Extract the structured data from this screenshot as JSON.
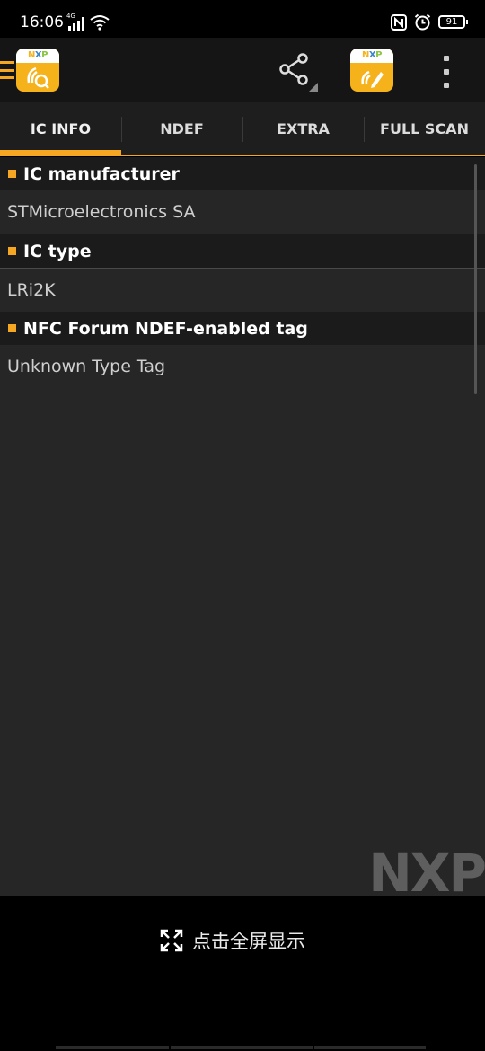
{
  "status_bar": {
    "time": "16:06",
    "network_type": "4G",
    "battery_level": "91"
  },
  "app_bar": {
    "menu_icon": "hamburger-icon",
    "logo_label": "NXP",
    "share_icon": "share-icon",
    "tagwriter_label": "NXP",
    "overflow_icon": "more-vert-icon"
  },
  "tabs": [
    {
      "label": "IC INFO",
      "active": true
    },
    {
      "label": "NDEF",
      "active": false
    },
    {
      "label": "EXTRA",
      "active": false
    },
    {
      "label": "FULL SCAN",
      "active": false
    }
  ],
  "sections": [
    {
      "title": "IC manufacturer",
      "value": "STMicroelectronics SA"
    },
    {
      "title": "IC type",
      "value": "LRi2K"
    },
    {
      "title": "NFC Forum NDEF-enabled tag",
      "value": "Unknown Type Tag"
    }
  ],
  "watermark": "NXP",
  "bottom": {
    "fullscreen_label": "点击全屏显示"
  },
  "colors": {
    "accent": "#f5a623",
    "background": "#262626",
    "header": "#1b1b1b"
  }
}
